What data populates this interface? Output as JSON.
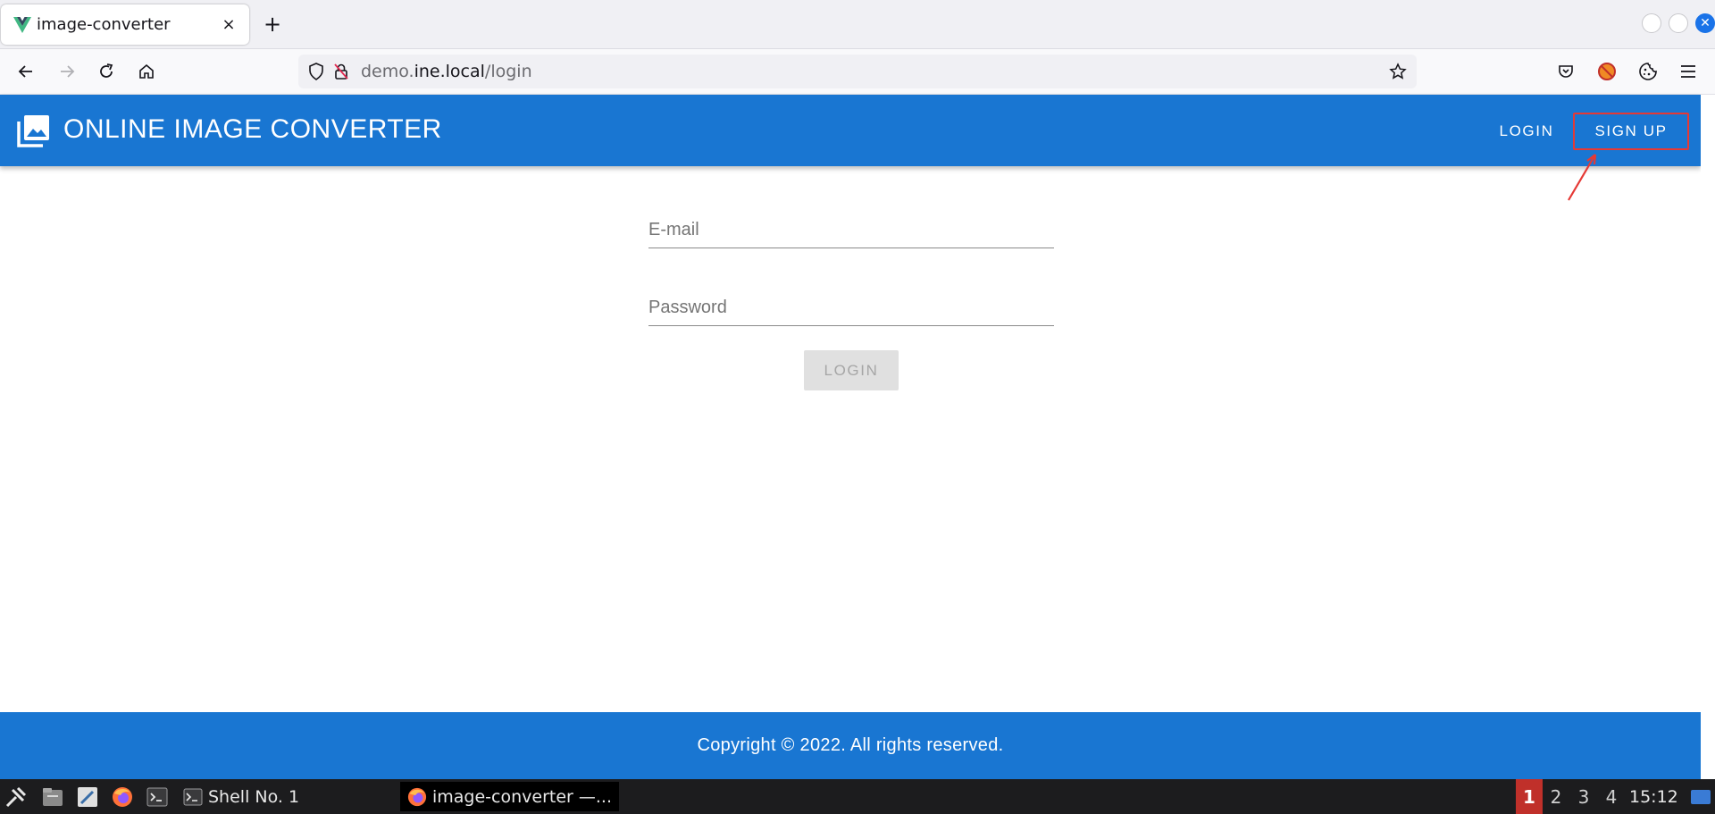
{
  "browser": {
    "tab_title": "image-converter",
    "tab_close": "×",
    "new_tab": "+",
    "url_prefix": "demo.",
    "url_host": "ine.local",
    "url_path": "/login"
  },
  "app": {
    "title": "ONLINE IMAGE CONVERTER",
    "nav_login": "LOGIN",
    "nav_signup": "SIGN UP"
  },
  "form": {
    "email_placeholder": "E-mail",
    "password_placeholder": "Password",
    "login_button": "LOGIN"
  },
  "footer": {
    "text": "Copyright © 2022. All rights reserved."
  },
  "taskbar": {
    "shell_task": "Shell No. 1",
    "browser_task": "image-converter —...",
    "workspaces": [
      "1",
      "2",
      "3",
      "4"
    ],
    "clock": "15:12"
  },
  "colors": {
    "brand": "#1976d2",
    "highlight": "#e53935"
  }
}
